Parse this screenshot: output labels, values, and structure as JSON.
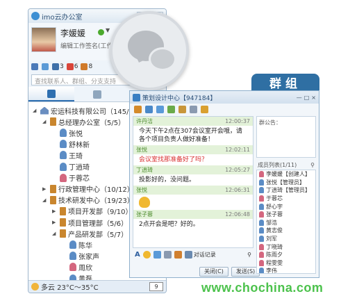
{
  "main_window": {
    "app_title": "imo云办公室",
    "user_name": "李媛媛",
    "signature_placeholder": "编辑工作签名(工作状",
    "quickbar": [
      {
        "icon": "mail-icon",
        "count": "",
        "color": "#4a79b8"
      },
      {
        "icon": "note-icon",
        "count": "",
        "color": "#5b9ad6"
      },
      {
        "icon": "message-icon",
        "count": "3",
        "color": "#3d6fa8"
      },
      {
        "icon": "alert-icon",
        "count": "6",
        "color": "#d9453a"
      },
      {
        "icon": "apps-icon",
        "count": "8",
        "color": "#d07a2a"
      }
    ],
    "search_placeholder": "查找联系人、群组、分支支持",
    "tabs": [
      "organization-tab",
      "contacts-tab",
      "groups-tab"
    ],
    "tree": [
      {
        "label": "宏运科技有限公司（145/211）",
        "type": "company",
        "level": 0,
        "expanded": true
      },
      {
        "label": "总经理办公室（5/5）",
        "type": "dept",
        "level": 1,
        "expanded": true
      },
      {
        "label": "张悦",
        "type": "person",
        "gender": "m",
        "level": 2
      },
      {
        "label": "舒林新",
        "type": "person",
        "gender": "m",
        "level": 2
      },
      {
        "label": "王琦",
        "type": "person",
        "gender": "m",
        "level": 2
      },
      {
        "label": "丁逍琦",
        "type": "person",
        "gender": "m",
        "level": 2
      },
      {
        "label": "于蓉芯",
        "type": "person",
        "gender": "f",
        "level": 2
      },
      {
        "label": "行政管理中心（10/12）",
        "type": "dept",
        "level": 1,
        "expanded": false
      },
      {
        "label": "技术研发中心（19/23）",
        "type": "dept",
        "level": 1,
        "expanded": true
      },
      {
        "label": "项目开发部（9/10）",
        "type": "dept",
        "level": 2,
        "expanded": false
      },
      {
        "label": "项目管理部（5/6）",
        "type": "dept",
        "level": 2,
        "expanded": false
      },
      {
        "label": "产品研发部（5/7）",
        "type": "dept",
        "level": 2,
        "expanded": true
      },
      {
        "label": "陈华",
        "type": "person",
        "gender": "m",
        "level": 3
      },
      {
        "label": "张家声",
        "type": "person",
        "gender": "m",
        "level": 3
      },
      {
        "label": "周欣",
        "type": "person",
        "gender": "f",
        "level": 3
      },
      {
        "label": "黄磊",
        "type": "person",
        "gender": "m",
        "level": 3
      }
    ],
    "weather": "多云 23°C～35°C",
    "calendar_day": "9"
  },
  "group_badge": "群组",
  "chat_window": {
    "title": "策划设计中心【947184】",
    "window_controls": [
      "—",
      "□",
      "×"
    ],
    "messages": [
      {
        "sender": "许丹洁",
        "time": "12:00:37",
        "text": "今天下午2点在307会议室开会哦，请各个项目负责人做好准备！",
        "style": "normal"
      },
      {
        "sender": "张悦",
        "time": "12:02:11",
        "text": "会议室找那准备好了吗？",
        "style": "red"
      },
      {
        "sender": "丁逍琦",
        "time": "12:05:27",
        "text": "投影好的，没问题。",
        "style": "normal"
      },
      {
        "sender": "张悦",
        "time": "12:06:31",
        "text": "",
        "style": "emoji"
      },
      {
        "sender": "张子蓉",
        "time": "12:06:48",
        "text": "2点开会是吧？好的。",
        "style": "normal"
      }
    ],
    "record_label": "对话记录",
    "close_button": "关闭(C)",
    "send_button": "发送(S)",
    "notice_label": "群公告：",
    "members_label": "成员列表(1/11)",
    "members": [
      {
        "name": "李媛媛【创建人】",
        "gender": "f"
      },
      {
        "name": "张悦【管理员】",
        "gender": "m"
      },
      {
        "name": "丁逍琦【管理员】",
        "gender": "m"
      },
      {
        "name": "于蓉芯",
        "gender": "f"
      },
      {
        "name": "舒心宇",
        "gender": "m"
      },
      {
        "name": "张子蓉",
        "gender": "f"
      },
      {
        "name": "邹浩",
        "gender": "m"
      },
      {
        "name": "黄志俊",
        "gender": "m"
      },
      {
        "name": "刘军",
        "gender": "m"
      },
      {
        "name": "丁晓琦",
        "gender": "f"
      },
      {
        "name": "陈雨夕",
        "gender": "f"
      },
      {
        "name": "程雯雯",
        "gender": "f"
      },
      {
        "name": "李伟",
        "gender": "m"
      }
    ]
  },
  "watermark": "www.chochina.com"
}
